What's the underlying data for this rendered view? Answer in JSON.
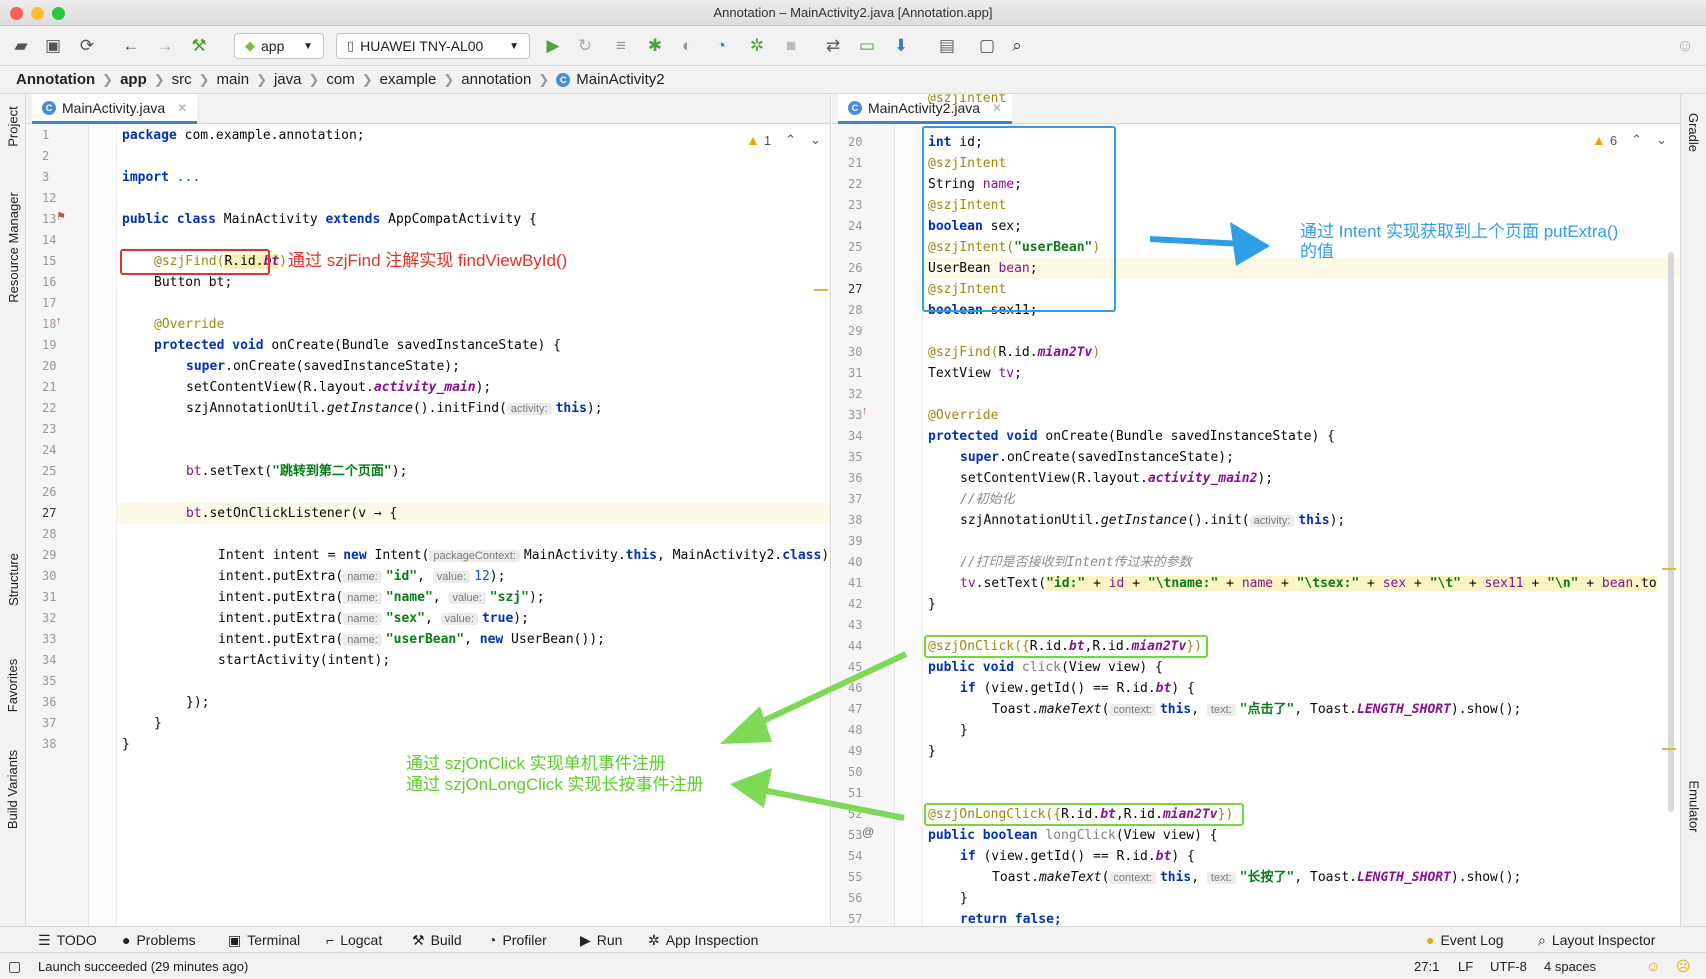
{
  "window": {
    "title": "Annotation – MainActivity2.java [Annotation.app]"
  },
  "toolbar": {
    "run_config": "app",
    "device": "HUAWEI TNY-AL00"
  },
  "breadcrumbs": [
    "Annotation",
    "app",
    "src",
    "main",
    "java",
    "com",
    "example",
    "annotation",
    "MainActivity2"
  ],
  "left_strip": {
    "project": "Project",
    "resource_manager": "Resource Manager",
    "structure": "Structure",
    "favorites": "Favorites",
    "build_variants": "Build Variants"
  },
  "right_strip": {
    "gradle": "Gradle",
    "emulator": "Emulator"
  },
  "left_editor": {
    "tab": "MainActivity.java",
    "warnings": "1",
    "line_numbers": [
      "1",
      "2",
      "3",
      "12",
      "13",
      "14",
      "15",
      "16",
      "17",
      "18",
      "19",
      "20",
      "21",
      "22",
      "23",
      "24",
      "25",
      "26",
      "27",
      "28",
      "29",
      "30",
      "31",
      "32",
      "33",
      "34",
      "35",
      "36",
      "37",
      "38"
    ],
    "code": {
      "l1a": "package",
      "l1b": " com.example.annotation;",
      "l3a": "import",
      "l3b": " ...",
      "l13a": "public class",
      "l13b": " MainActivity ",
      "l13c": "extends",
      "l13d": " AppCompatActivity {",
      "l15a": "@szjFind(",
      "l15b": "R.id.",
      "l15c": "bt",
      "l15d": ")",
      "l16": "Button bt;",
      "l18": "@Override",
      "l19a": "protected void",
      "l19b": " onCreate(Bundle savedInstanceState) {",
      "l20a": "super",
      "l20b": ".onCreate(savedInstanceState);",
      "l21a": "setContentView(R.layout.",
      "l21b": "activity_main",
      "l21c": ");",
      "l22a": "szjAnnotationUtil.",
      "l22b": "getInstance",
      "l22c": "().initFind(",
      "l22h": "activity:",
      "l22d": "this",
      "l22e": ");",
      "l25a": "bt",
      "l25b": ".setText(",
      "l25c": "\"跳转到第二个页面\"",
      "l25d": ");",
      "l27a": "bt",
      "l27b": ".setOnClickListener(v → {",
      "l29a": "Intent intent = ",
      "l29b": "new",
      "l29c": " Intent(",
      "l29h": "packageContext:",
      "l29d": "MainActivity.",
      "l29e": "this",
      "l29f": ", MainActivity2.",
      "l29g": "class",
      "l29i": ")",
      "l30a": "intent.putExtra(",
      "l30h1": "name:",
      "l30b": "\"id\"",
      "l30c": ", ",
      "l30h2": "value:",
      "l30d": "12",
      "l30e": ");",
      "l31a": "intent.putExtra(",
      "l31h1": "name:",
      "l31b": "\"name\"",
      "l31c": ", ",
      "l31h2": "value:",
      "l31d": "\"szj\"",
      "l31e": ");",
      "l32a": "intent.putExtra(",
      "l32h1": "name:",
      "l32b": "\"sex\"",
      "l32c": ", ",
      "l32h2": "value:",
      "l32d": "true",
      "l32e": ");",
      "l33a": "intent.putExtra(",
      "l33h1": "name:",
      "l33b": "\"userBean\"",
      "l33c": ", ",
      "l33d": "new",
      "l33e": " UserBean());",
      "l34": "startActivity(intent);",
      "l36": "});",
      "l37": "}",
      "l38": "}"
    }
  },
  "right_editor": {
    "tab": "MainActivity2.java",
    "warnings": "6",
    "line_numbers": [
      "20",
      "21",
      "22",
      "23",
      "24",
      "25",
      "26",
      "27",
      "28",
      "29",
      "30",
      "31",
      "32",
      "33",
      "34",
      "35",
      "36",
      "37",
      "38",
      "39",
      "40",
      "41",
      "42",
      "43",
      "44",
      "45",
      "46",
      "47",
      "48",
      "49",
      "50",
      "51",
      "52",
      "53",
      "54",
      "55",
      "56",
      "57"
    ],
    "code": {
      "l19": "@szjIntent",
      "l20a": "int",
      "l20b": " id;",
      "l21": "@szjIntent",
      "l22a": "String ",
      "l22b": "name",
      "l22c": ";",
      "l23": "@szjIntent",
      "l24a": "boolean",
      "l24b": " sex;",
      "l25a": "@szjIntent(",
      "l25b": "\"userBean\"",
      "l25c": ")",
      "l26a": "UserBean ",
      "l26b": "bean",
      "l26c": ";",
      "l27": "@szjIntent",
      "l28a": "boolean",
      "l28b": " sex11;",
      "l30a": "@szjFind(",
      "l30b": "R.id.",
      "l30c": "mian2Tv",
      "l30d": ")",
      "l31a": "TextView ",
      "l31b": "tv",
      "l31c": ";",
      "l33": "@Override",
      "l34a": "protected void",
      "l34b": " onCreate(Bundle savedInstanceState) {",
      "l35a": "super",
      "l35b": ".onCreate(savedInstanceState);",
      "l36a": "setContentView(R.layout.",
      "l36b": "activity_main2",
      "l36c": ");",
      "l37": "//初始化",
      "l38a": "szjAnnotationUtil.",
      "l38b": "getInstance",
      "l38c": "().init(",
      "l38h": "activity:",
      "l38d": "this",
      "l38e": ");",
      "l40": "//打印是否接收到Intent传过来的参数",
      "l41a": "tv",
      "l41b": ".setText(",
      "l41c": "\"id:\"",
      "l41d": " + ",
      "l41e": "id",
      "l41f": " + ",
      "l41g": "\"\\tname:\"",
      "l41i": " + ",
      "l41j": "name",
      "l41k": " + ",
      "l41l": "\"\\tsex:\"",
      "l41m": " + ",
      "l41n": "sex",
      "l41o": " + ",
      "l41p": "\"\\t\"",
      "l41q": " + ",
      "l41r": "sex11",
      "l41s": " + ",
      "l41t": "\"\\n\"",
      "l41u": " + ",
      "l41v": "bean",
      "l41w": ".to",
      "l42": "}",
      "l44a": "@szjOnClick({",
      "l44b": "R.id.",
      "l44c": "bt",
      "l44d": ",R.id.",
      "l44e": "mian2Tv",
      "l44f": "})",
      "l45a": "public void",
      "l45b": " click",
      "l45c": "(View view) {",
      "l46a": "if",
      "l46b": " (view.getId() == R.id.",
      "l46c": "bt",
      "l46d": ") {",
      "l47a": "Toast.",
      "l47b": "makeText",
      "l47c": "(",
      "l47h1": "context:",
      "l47d": "this",
      "l47e": ", ",
      "l47h2": "text:",
      "l47f": "\"点击了\"",
      "l47g": ", Toast.",
      "l47i": "LENGTH_SHORT",
      "l47j": ").show();",
      "l48": "}",
      "l49": "}",
      "l52a": "@szjOnLongClick({",
      "l52b": "R.id.",
      "l52c": "bt",
      "l52d": ",R.id.",
      "l52e": "mian2Tv",
      "l52f": "})",
      "l53a": "public boolean",
      "l53b": " longClick",
      "l53c": "(View view) {",
      "l54a": "if",
      "l54b": " (view.getId() == R.id.",
      "l54c": "bt",
      "l54d": ") {",
      "l55a": "Toast.",
      "l55b": "makeText",
      "l55c": "(",
      "l55h1": "context:",
      "l55d": "this",
      "l55e": ", ",
      "l55h2": "text:",
      "l55f": "\"长按了\"",
      "l55g": ", Toast.",
      "l55i": "LENGTH_SHORT",
      "l55j": ").show();",
      "l56": "}",
      "l57a": "return",
      "l57b": " false;"
    }
  },
  "annotations": {
    "find_note": "通过 szjFind 注解实现 findViewById()",
    "intent_note_1": "通过 Intent 实现获取到上个页面 putExtra()",
    "intent_note_2": "的值",
    "click_note_1": "通过 szjOnClick 实现单机事件注册",
    "click_note_2": "通过 szjOnLongClick 实现长按事件注册"
  },
  "bottom_tabs": {
    "todo": "TODO",
    "problems": "Problems",
    "terminal": "Terminal",
    "logcat": "Logcat",
    "build": "Build",
    "profiler": "Profiler",
    "run": "Run",
    "app_inspection": "App Inspection",
    "event_log": "Event Log",
    "layout_inspector": "Layout Inspector"
  },
  "status": {
    "message": "Launch succeeded (29 minutes ago)",
    "position": "27:1",
    "line_sep": "LF",
    "encoding": "UTF-8",
    "indent": "4 spaces"
  },
  "colors": {
    "annotation_red": "#e03226",
    "annotation_blue": "#2f9ee6",
    "annotation_green": "#76d641"
  }
}
